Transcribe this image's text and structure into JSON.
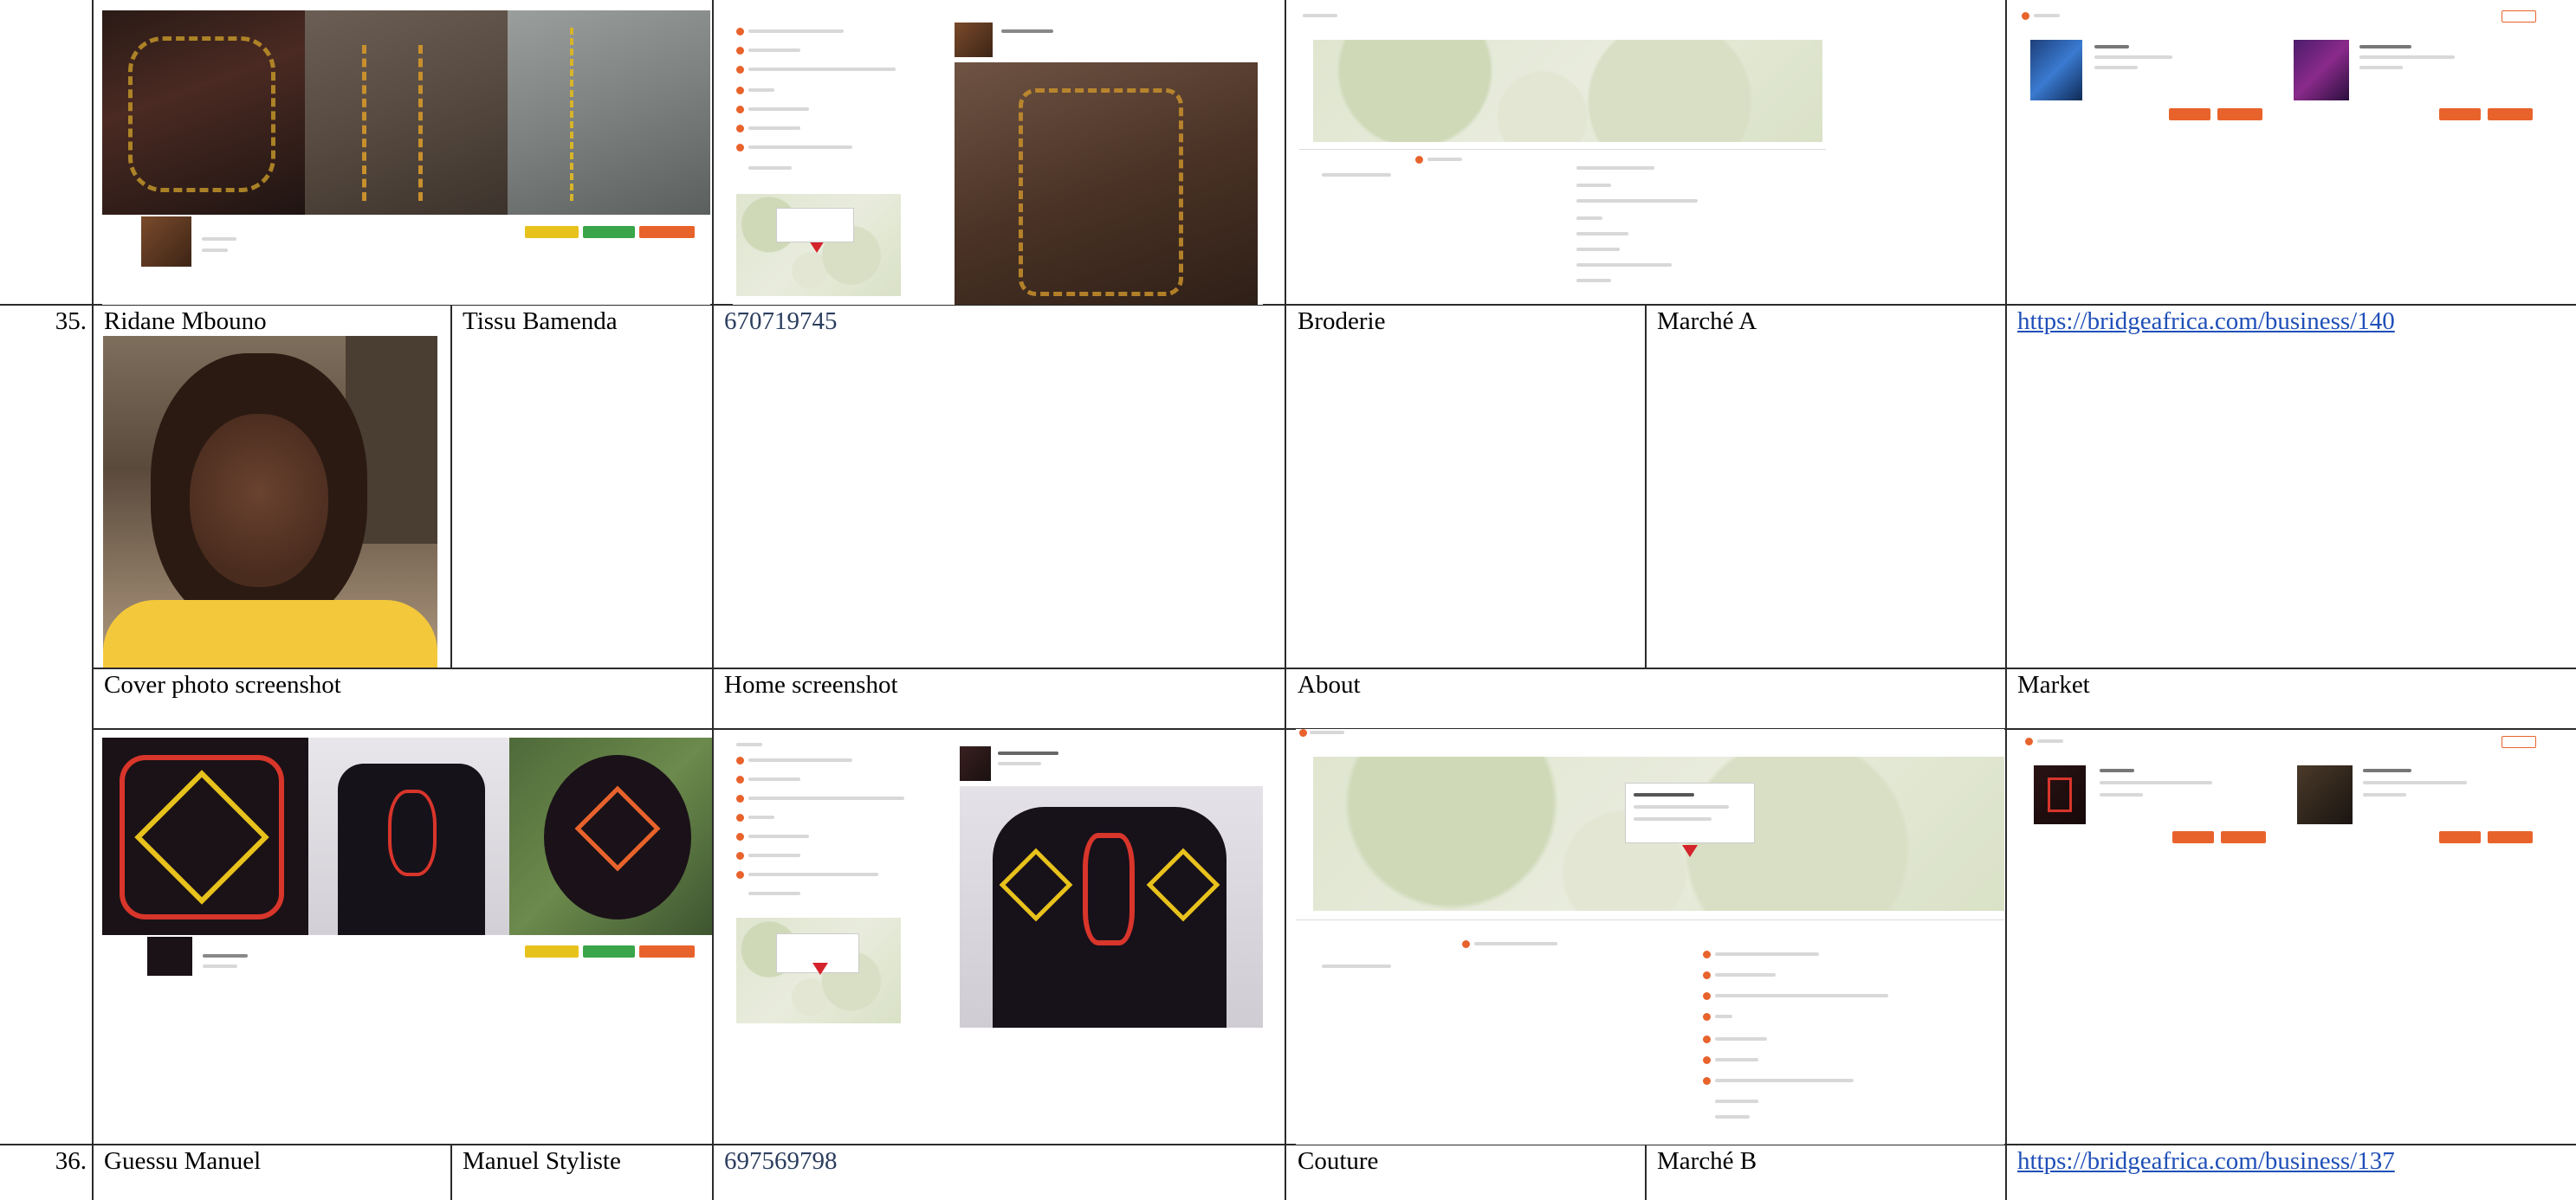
{
  "rows": [
    {
      "number": "35.",
      "owner_name": "Ridane Mbouno",
      "business_name": "Tissu Bamenda",
      "phone": "670719745",
      "category": "Broderie",
      "market": "Marché A",
      "profile_url": "https://bridgeafrica.com/business/140",
      "section_labels": {
        "cover": "Cover photo screenshot",
        "home": "Home screenshot",
        "about": "About",
        "market": "Market"
      }
    },
    {
      "number": "36.",
      "owner_name": "Guessu Manuel",
      "business_name": "Manuel Styliste",
      "phone": "697569798",
      "category": "Couture",
      "market": "Marché B",
      "profile_url": "https://bridgeafrica.com/business/137"
    }
  ],
  "colors": {
    "table_border": "#2b2b2b",
    "phone_text": "#2c3e5f",
    "link": "#1f4fb8",
    "accent_orange": "#e8632c",
    "button_yellow": "#e8c21c",
    "button_green": "#3aa54a"
  },
  "icons": [
    "map-pin-icon",
    "phone-icon",
    "location-icon",
    "store-icon"
  ]
}
